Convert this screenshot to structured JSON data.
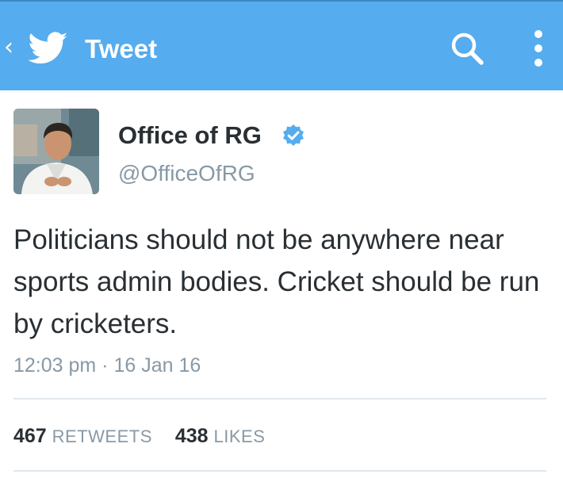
{
  "appbar": {
    "title": "Tweet",
    "back_icon": "chevron-left-icon",
    "logo_icon": "twitter-bird-icon",
    "search_icon": "search-icon",
    "more_icon": "more-vertical-icon",
    "color": "#55acee"
  },
  "author": {
    "name": "Office of RG",
    "handle": "@OfficeOfRG",
    "verified": true,
    "verified_color": "#55acee"
  },
  "tweet": {
    "text": "Politicians should not be anywhere near sports admin bodies. Cricket should be run by cricketers.",
    "timestamp": "12:03 pm · 16 Jan 16"
  },
  "stats": {
    "retweets_count": "467",
    "retweets_label": "RETWEETS",
    "likes_count": "438",
    "likes_label": "LIKES"
  }
}
